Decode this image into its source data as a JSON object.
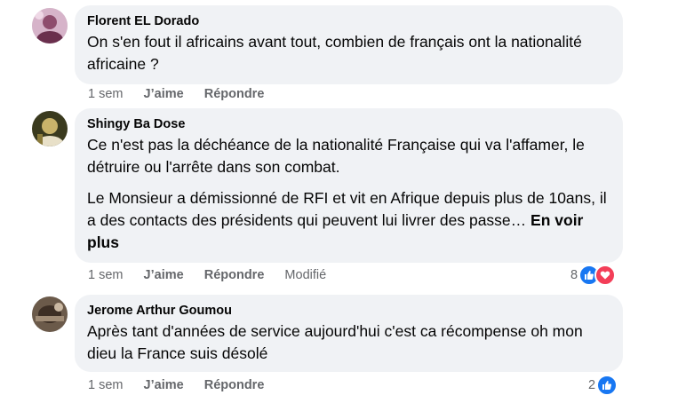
{
  "comments": [
    {
      "author": "Florent EL Dorado",
      "paragraphs": [
        "On s'en fout il africains avant tout, combien de français ont la nationalité africaine ?"
      ],
      "time": "1 sem",
      "like_label": "J’aime",
      "reply_label": "Répondre"
    },
    {
      "author": "Shingy Ba Dose",
      "paragraphs": [
        "Ce n'est pas la déchéance de la nationalité Française qui va l'affamer, le détruire ou l'arrête dans son combat.",
        "Le Monsieur a démissionné de RFI et vit en Afrique depuis plus de 10ans, il a des contacts des présidents qui peuvent lui livrer des passe…"
      ],
      "see_more": "En voir plus",
      "time": "1 sem",
      "like_label": "J’aime",
      "reply_label": "Répondre",
      "edited_label": "Modifié",
      "reaction_count": "8",
      "reactions": [
        "like-icon",
        "love-icon"
      ]
    },
    {
      "author": "Jerome Arthur Goumou",
      "paragraphs": [
        "Après tant d'années de service aujourd'hui c'est ca récompense oh mon dieu la France suis désolé"
      ],
      "time": "1 sem",
      "like_label": "J’aime",
      "reply_label": "Répondre",
      "reaction_count": "2",
      "reactions": [
        "like-icon"
      ]
    }
  ],
  "colors": {
    "bubble": "#f0f2f5",
    "meta": "#65676b",
    "like": "#1877f2",
    "love": "#f33e58"
  }
}
